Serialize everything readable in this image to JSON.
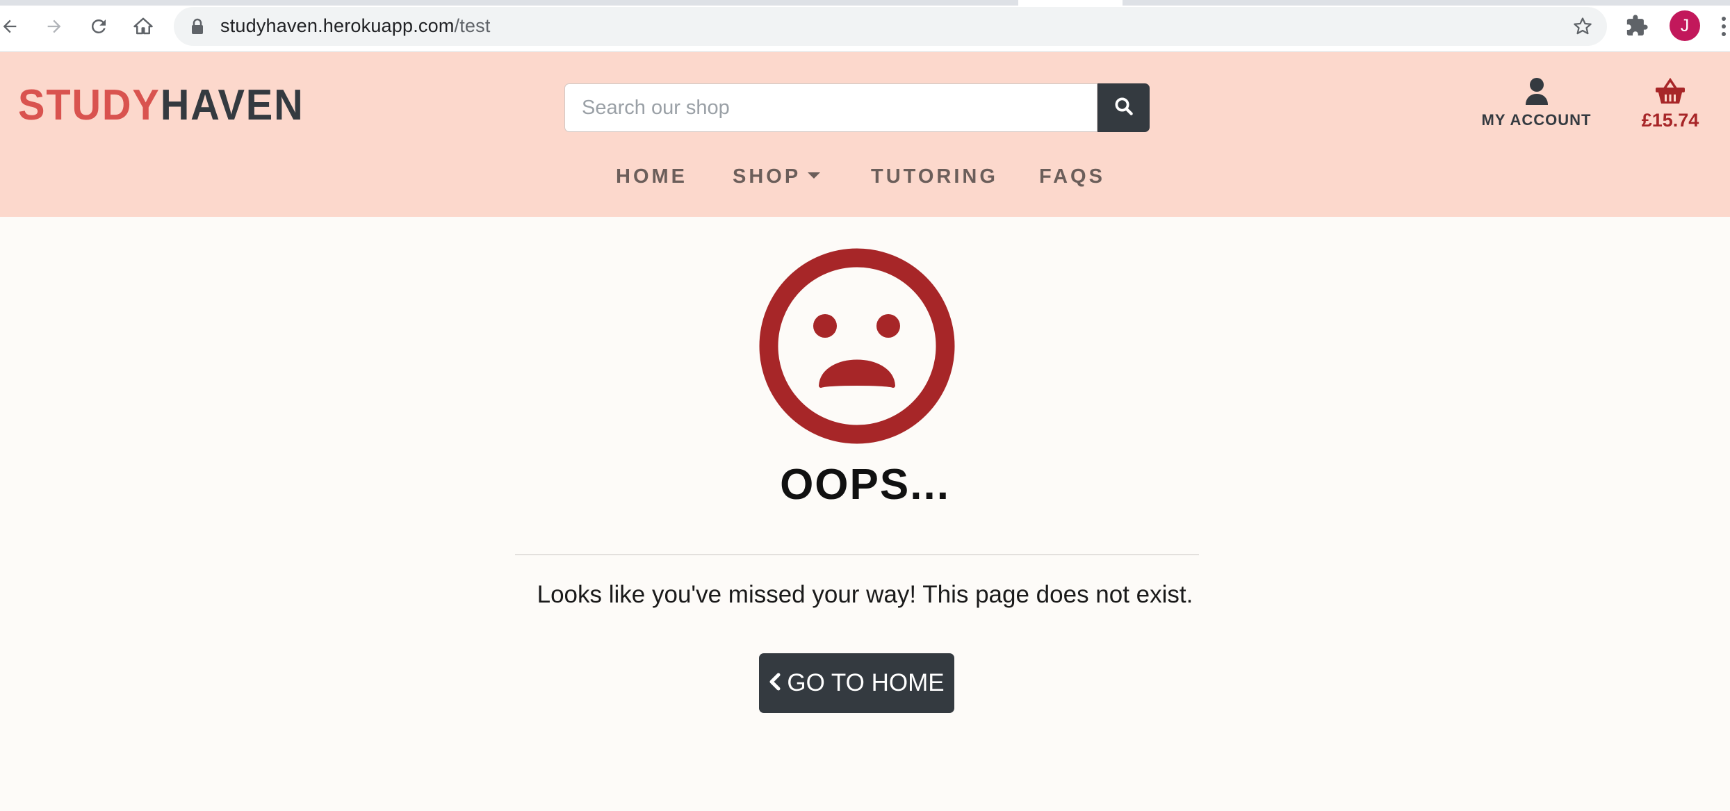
{
  "browser": {
    "url_host": "studyhaven.herokuapp.com",
    "url_path": "/test",
    "profile_initial": "J",
    "icons": [
      "back-arrow-icon",
      "forward-arrow-icon",
      "reload-icon",
      "home-icon",
      "lock-icon",
      "bookmark-star-icon",
      "extensions-puzzle-icon",
      "menu-kebab-icon"
    ]
  },
  "header": {
    "logo_part1": "STUDY",
    "logo_part2": "HAVEN",
    "search_placeholder": "Search our shop",
    "search_icon": "search-icon",
    "account_label": "MY ACCOUNT",
    "account_icon": "user-icon",
    "basket_icon": "shopping-basket-icon",
    "basket_total": "£15.74"
  },
  "nav": {
    "items": [
      {
        "label": "HOME"
      },
      {
        "label": "SHOP",
        "has_dropdown": true
      },
      {
        "label": "TUTORING"
      },
      {
        "label": "FAQS"
      }
    ]
  },
  "error_page": {
    "icon": "sad-face-icon",
    "heading": "OOPS...",
    "message": "Looks like you've missed your way! This page does not exist.",
    "button_label": "GO TO HOME",
    "button_icon": "chevron-left-icon"
  },
  "colors": {
    "header_bg": "#fcd8cc",
    "logo_accent": "#d9534f",
    "logo_dark": "#343a40",
    "nav_text": "#6b5e5a",
    "sad_face": "#a72628",
    "page_bg": "#fdfbf8",
    "button_bg": "#343a40"
  }
}
